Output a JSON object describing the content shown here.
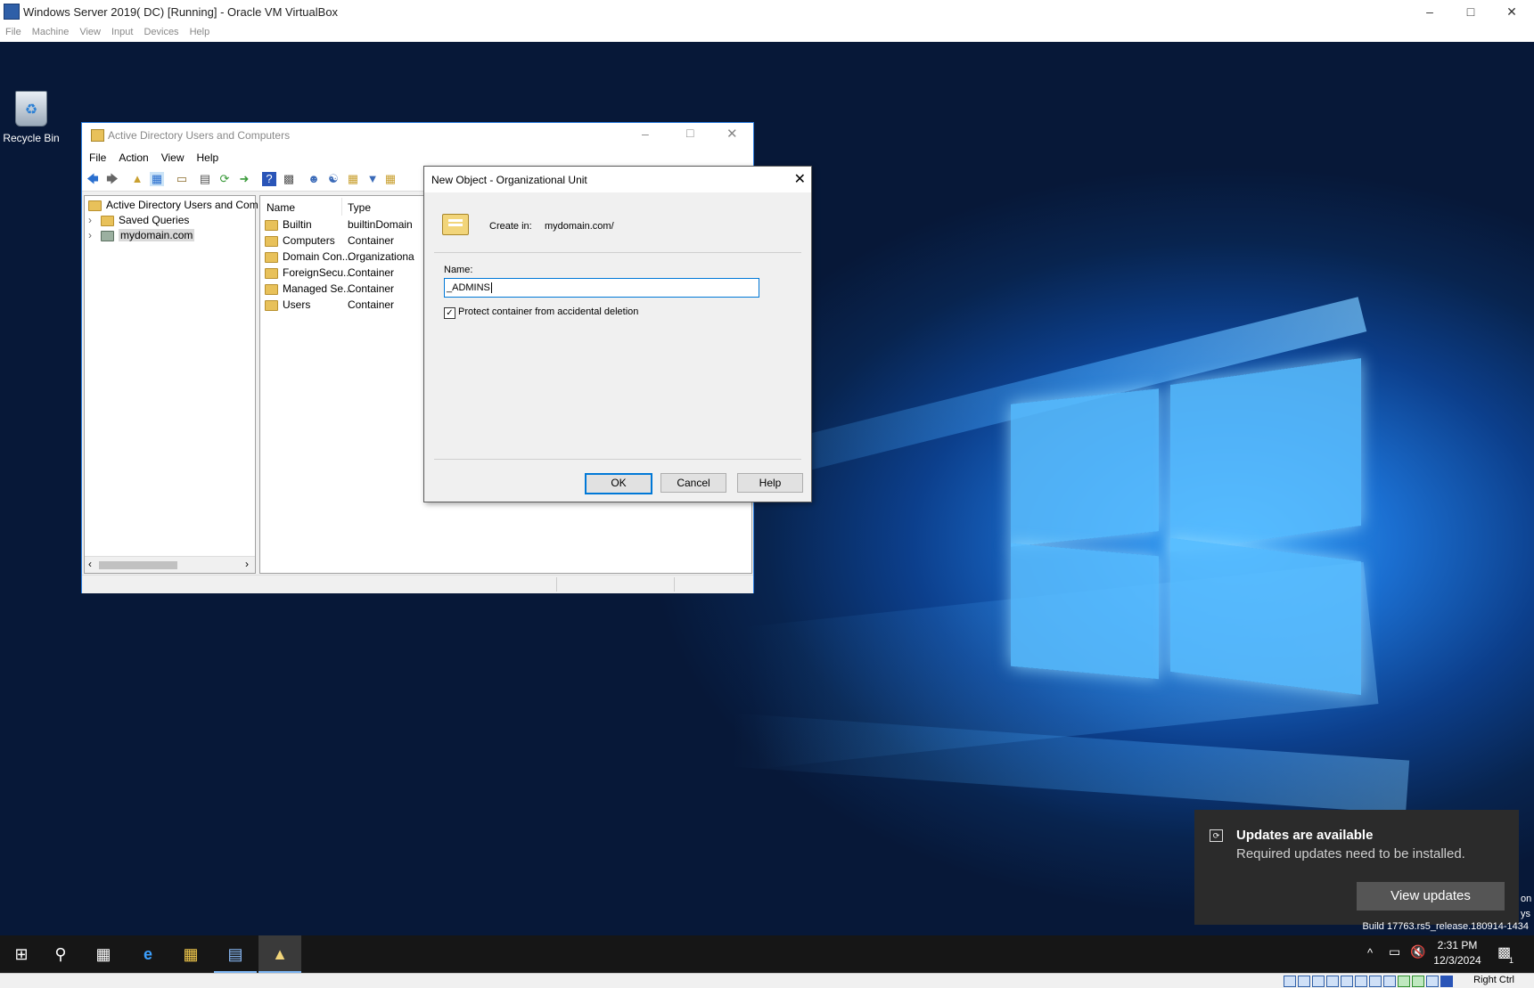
{
  "host": {
    "title": "Windows Server 2019( DC) [Running] - Oracle VM VirtualBox",
    "menu": [
      "File",
      "Machine",
      "View",
      "Input",
      "Devices",
      "Help"
    ],
    "status_right": "Right Ctrl"
  },
  "desktop": {
    "recycle_bin_label": "Recycle Bin",
    "build_text": "Build 17763.rs5_release.180914-1434"
  },
  "aduc": {
    "title": "Active Directory Users and Computers",
    "menu": [
      "File",
      "Action",
      "View",
      "Help"
    ],
    "tree": {
      "root": "Active Directory Users and Com",
      "items": [
        "Saved Queries",
        "mydomain.com"
      ]
    },
    "columns": [
      "Name",
      "Type"
    ],
    "rows": [
      {
        "name": "Builtin",
        "type": "builtinDomain"
      },
      {
        "name": "Computers",
        "type": "Container"
      },
      {
        "name": "Domain Con...",
        "type": "Organizationa"
      },
      {
        "name": "ForeignSecu...",
        "type": "Container"
      },
      {
        "name": "Managed Se...",
        "type": "Container"
      },
      {
        "name": "Users",
        "type": "Container"
      }
    ]
  },
  "dialog": {
    "title": "New Object - Organizational Unit",
    "create_in_label": "Create in:",
    "create_in_value": "mydomain.com/",
    "name_label": "Name:",
    "name_value": "_ADMINS",
    "protect_label": "Protect container from accidental deletion",
    "protect_checked": true,
    "ok_label": "OK",
    "cancel_label": "Cancel",
    "help_label": "Help"
  },
  "toast": {
    "heading": "Updates are available",
    "body": "Required updates need to be installed.",
    "button": "View updates",
    "side_text": [
      "on",
      "ys"
    ]
  },
  "taskbar": {
    "time": "2:31 PM",
    "date": "12/3/2024",
    "notification_count": "1"
  },
  "colors": {
    "accent": "#0078d7",
    "folder": "#e8c15a",
    "toast_bg": "#2b2b2b",
    "taskbar_bg": "#161616"
  }
}
